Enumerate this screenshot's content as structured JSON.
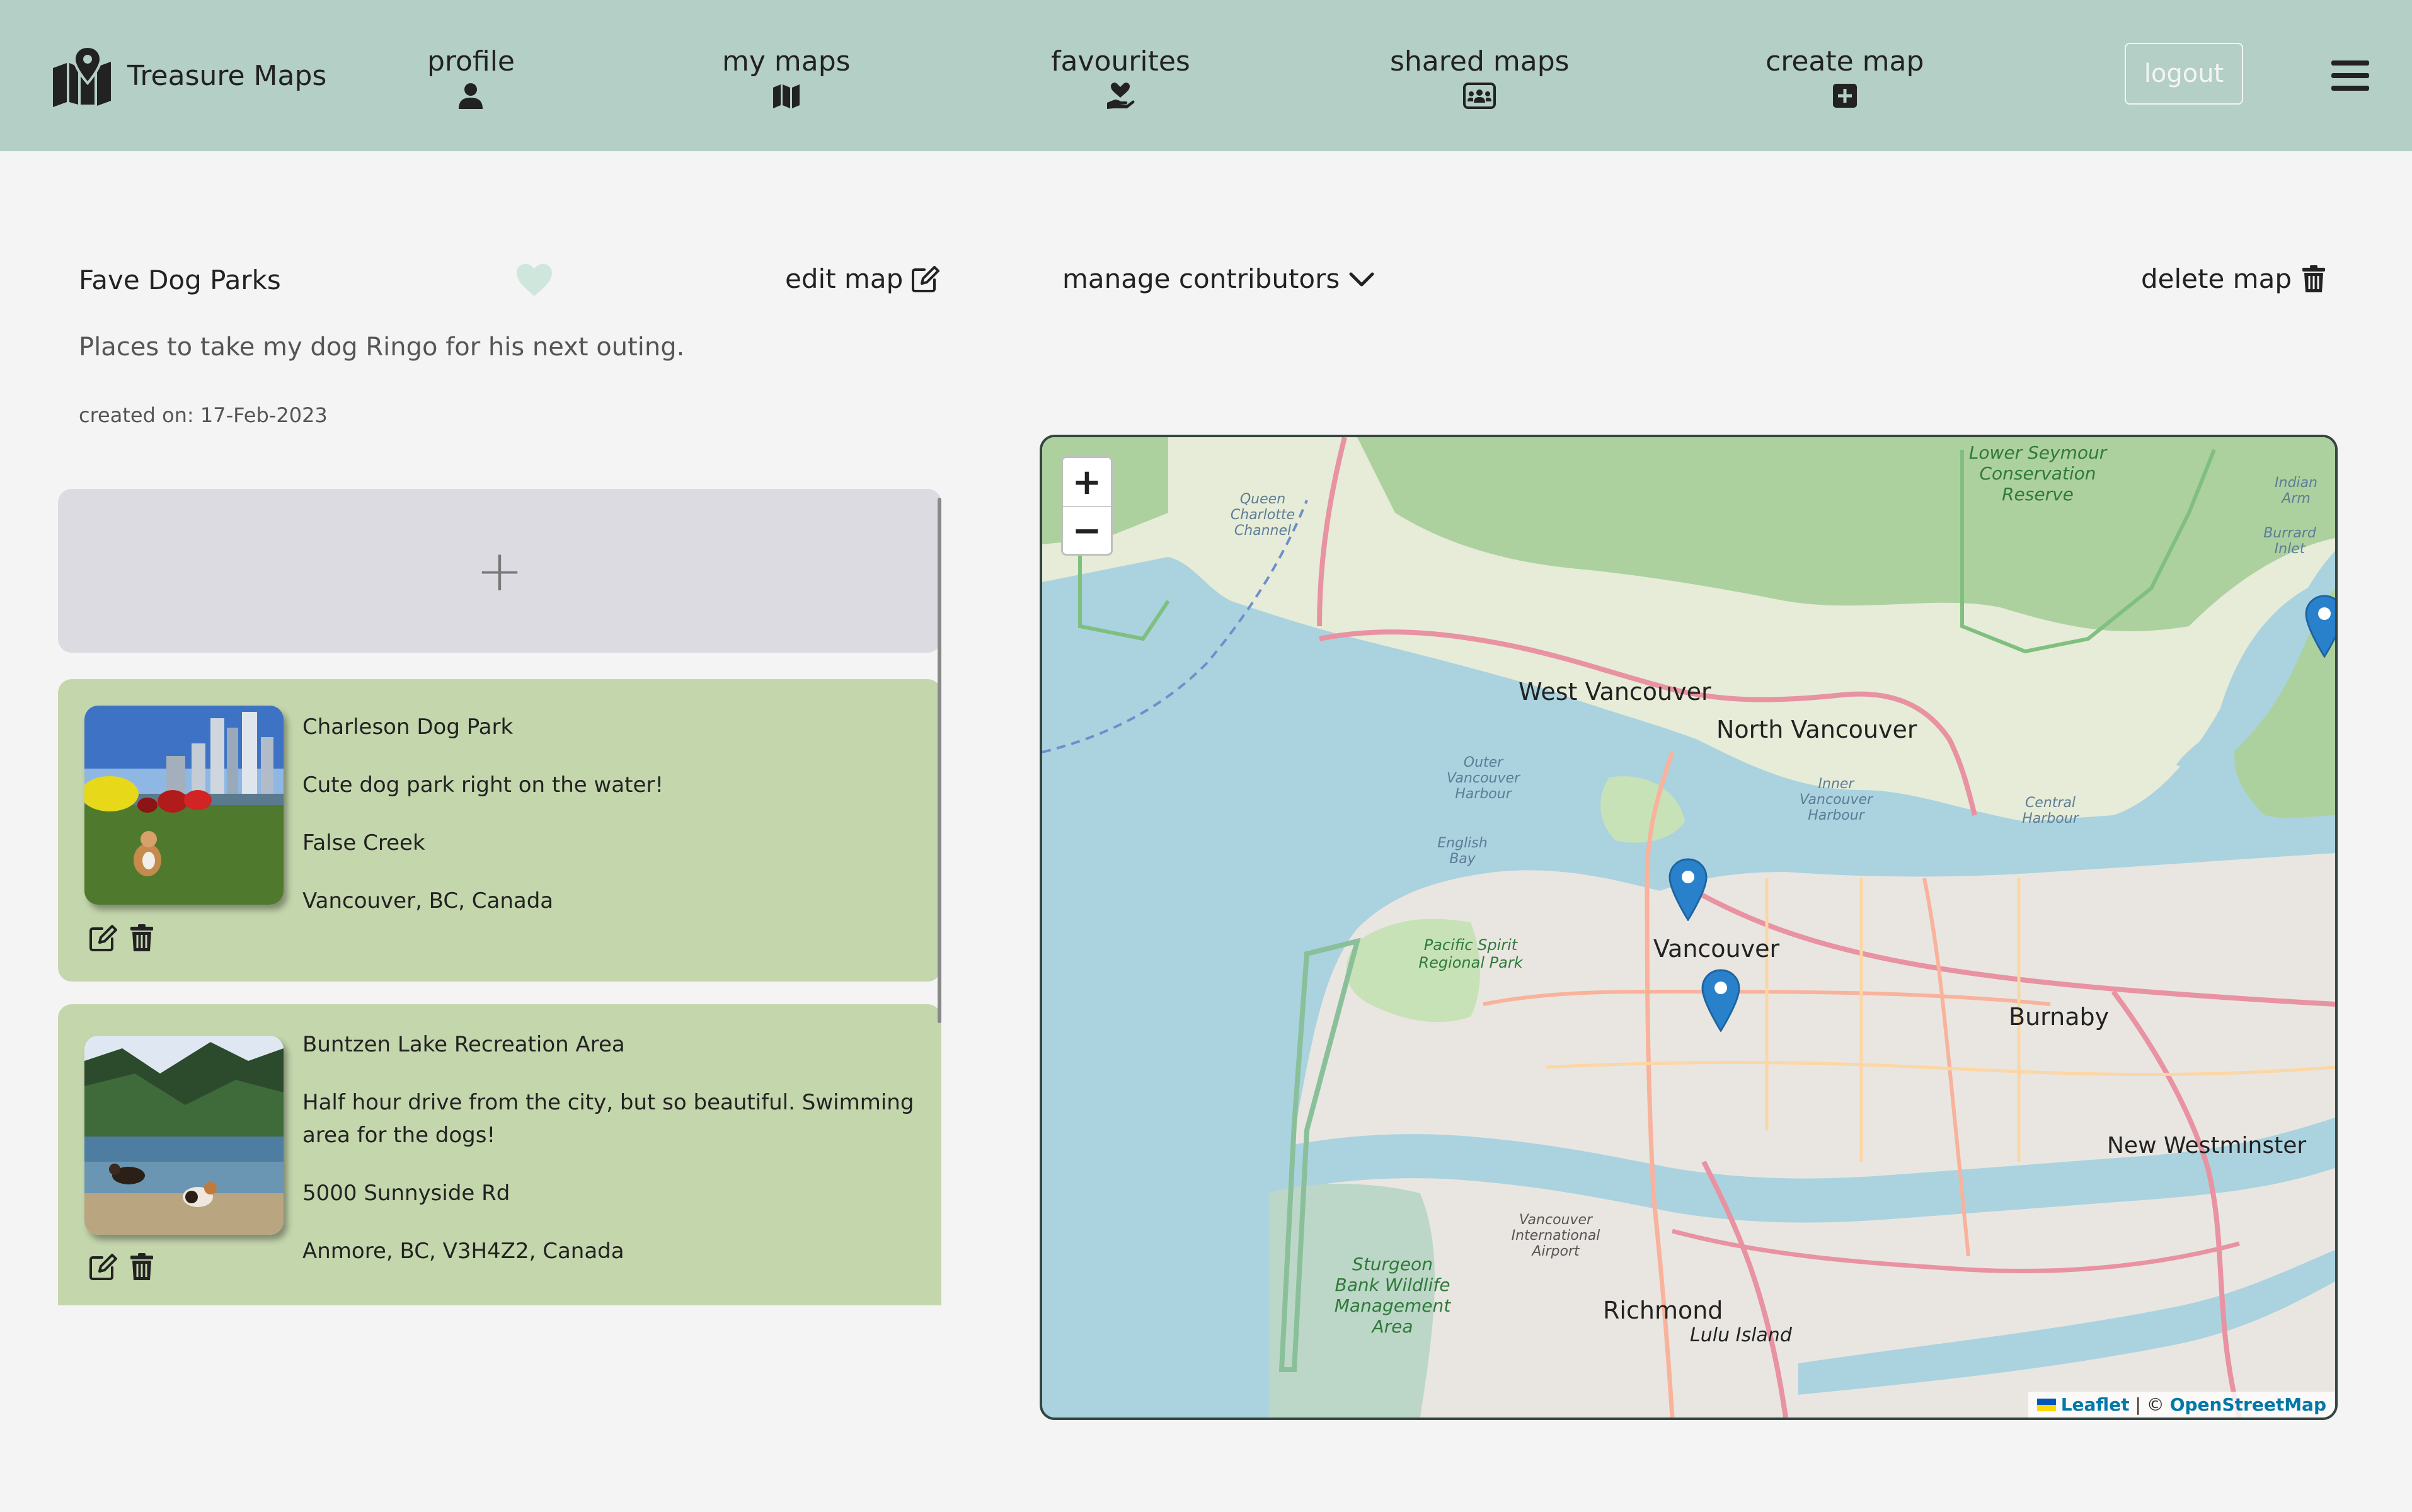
{
  "nav": {
    "brand": "Treasure Maps",
    "items": [
      {
        "label": "profile",
        "icon": "user-icon"
      },
      {
        "label": "my maps",
        "icon": "map-icon"
      },
      {
        "label": "favourites",
        "icon": "hand-heart-icon"
      },
      {
        "label": "shared maps",
        "icon": "users-icon"
      },
      {
        "label": "create map",
        "icon": "plus-square-icon"
      }
    ],
    "logout": "logout",
    "menu_icon": "hamburger-icon"
  },
  "map": {
    "title": "Fave Dog Parks",
    "edit_label": "edit map",
    "contributors_label": "manage contributors",
    "delete_label": "delete map",
    "description": "Places to take my dog Ringo for his next outing.",
    "created": "created on: 17-Feb-2023"
  },
  "list": {
    "add_symbol": "+",
    "pins": [
      {
        "name": "Charleson Dog Park",
        "description": "Cute dog park right on the water!",
        "address": "False Creek",
        "city": "Vancouver, BC, Canada"
      },
      {
        "name": "Buntzen Lake Recreation Area",
        "description": "Half hour drive from the city, but so beautiful. Swimming area for the dogs!",
        "address": "5000 Sunnyside Rd",
        "city": "Anmore, BC, V3H4Z2, Canada"
      }
    ]
  },
  "mapview": {
    "zoom_in": "+",
    "zoom_out": "−",
    "attribution_leaflet": "Leaflet",
    "attribution_sep": " | © ",
    "attribution_osm": "OpenStreetMap",
    "labels": {
      "west_vancouver": "West Vancouver",
      "north_vancouver": "North Vancouver",
      "vancouver": "Vancouver",
      "burnaby": "Burnaby",
      "new_westminster": "New Westminster",
      "richmond": "Richmond",
      "lulu_island": "Lulu Island",
      "lower_seymour": "Lower Seymour Conservation Reserve",
      "pacific_spirit": "Pacific Spirit Regional Park",
      "sturgeon_bank": "Sturgeon Bank Wildlife Management Area",
      "english_bay": "English Bay",
      "outer_harbour": "Outer Vancouver Harbour",
      "inner_harbour": "Inner Vancouver Harbour",
      "central_harbour": "Central Harbour",
      "queen_charlotte": "Queen Charlotte Channel",
      "airport": "Vancouver International Airport",
      "indian_arm": "Indian Arm",
      "burrard_inlet": "Burrard Inlet"
    }
  },
  "colors": {
    "navbar": "#b4cfc5",
    "pin_card": "#c4d6ac",
    "add_card": "#dddbe2",
    "background": "#f4f4f4",
    "heart": "#cfe6dc",
    "marker": "#2a81cb"
  }
}
